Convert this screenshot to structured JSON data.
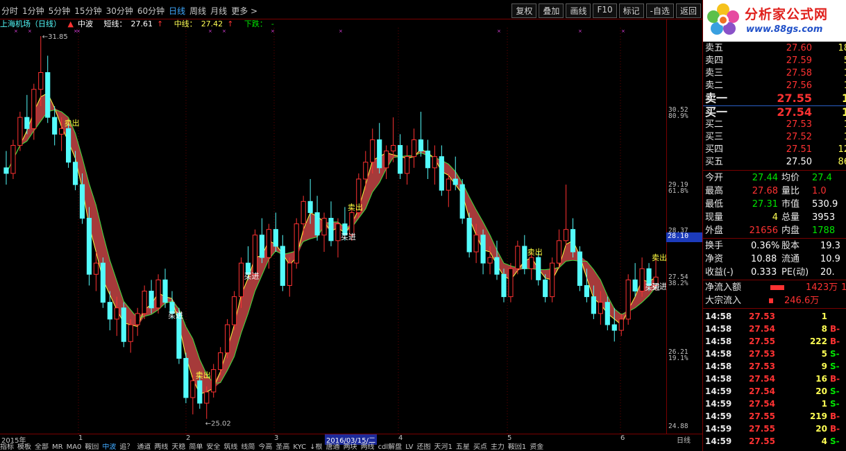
{
  "toolbar": {
    "periods": [
      "分时",
      "1分钟",
      "5分钟",
      "15分钟",
      "30分钟",
      "60分钟",
      "日线",
      "周线",
      "月线",
      "更多 >"
    ],
    "active_period": "日线",
    "tools": [
      "复权",
      "叠加",
      "画线",
      "F10",
      "标记",
      "-自选",
      "返回"
    ]
  },
  "indicator_line": {
    "stock": "上海机场（日线）",
    "indicator": "中波",
    "short_label": "短线：",
    "short_value": "27.61",
    "mid_label": "中线：",
    "mid_value": "27.42",
    "down_label": "下跌：",
    "down_value": "-"
  },
  "chart_data": {
    "type": "candlestick",
    "title": "上海机场（日线）",
    "ylim": [
      24.88,
      31.9
    ],
    "y_ticks": [
      {
        "price": "30.52",
        "pct": "80.9%"
      },
      {
        "price": "29.19",
        "pct": "61.8%"
      },
      {
        "price": "28.37",
        "pct": ""
      },
      {
        "price": "27.54",
        "pct": "38.2%"
      },
      {
        "price": "26.21",
        "pct": "19.1%"
      },
      {
        "price": "24.88",
        "pct": ""
      }
    ],
    "current_price": "28.10",
    "high_marker": "31.85",
    "low_marker": "25.02",
    "signals": [
      {
        "index": 9,
        "text": "卖出",
        "type": "sell"
      },
      {
        "index": 24,
        "text": "买进",
        "type": "buy"
      },
      {
        "index": 28,
        "text": "卖出",
        "type": "sell"
      },
      {
        "index": 35,
        "text": "买进",
        "type": "buy"
      },
      {
        "index": 49,
        "text": "买进",
        "type": "buy"
      },
      {
        "index": 50,
        "text": "卖出",
        "type": "sell"
      },
      {
        "index": 76,
        "text": "卖出",
        "type": "sell"
      },
      {
        "index": 93,
        "text": "买进",
        "type": "buy"
      },
      {
        "index": 103,
        "text": "卖出",
        "type": "sell"
      },
      {
        "index": 111,
        "text": "买进",
        "type": "buy"
      }
    ],
    "candles": [
      [
        29.5,
        29.8,
        29.2,
        29.4
      ],
      [
        29.4,
        30.0,
        29.3,
        29.9
      ],
      [
        29.9,
        30.5,
        29.8,
        30.4
      ],
      [
        30.4,
        30.8,
        30.1,
        30.2
      ],
      [
        30.2,
        31.0,
        30.0,
        30.9
      ],
      [
        30.9,
        31.85,
        30.6,
        31.2
      ],
      [
        31.2,
        31.5,
        30.3,
        30.4
      ],
      [
        30.4,
        30.6,
        29.9,
        30.1
      ],
      [
        30.1,
        30.4,
        29.8,
        30.2
      ],
      [
        30.2,
        30.3,
        29.5,
        29.6
      ],
      [
        29.6,
        29.8,
        29.1,
        29.2
      ],
      [
        29.2,
        29.4,
        28.5,
        28.6
      ],
      [
        28.6,
        28.8,
        27.4,
        27.6
      ],
      [
        27.6,
        28.0,
        27.3,
        27.8
      ],
      [
        27.8,
        27.9,
        27.0,
        27.1
      ],
      [
        27.1,
        27.3,
        26.6,
        26.8
      ],
      [
        26.8,
        27.2,
        26.5,
        27.0
      ],
      [
        27.0,
        27.1,
        26.3,
        26.4
      ],
      [
        26.4,
        26.8,
        26.2,
        26.7
      ],
      [
        26.7,
        27.0,
        26.5,
        26.9
      ],
      [
        26.9,
        27.4,
        26.8,
        27.3
      ],
      [
        27.3,
        27.5,
        26.9,
        27.0
      ],
      [
        27.0,
        27.6,
        26.9,
        27.5
      ],
      [
        27.5,
        27.7,
        27.0,
        27.1
      ],
      [
        27.1,
        27.3,
        26.8,
        26.9
      ],
      [
        26.9,
        27.0,
        26.0,
        26.1
      ],
      [
        26.1,
        26.2,
        25.3,
        25.4
      ],
      [
        25.4,
        25.8,
        25.1,
        25.7
      ],
      [
        25.7,
        25.8,
        25.2,
        25.3
      ],
      [
        25.3,
        25.6,
        25.02,
        25.5
      ],
      [
        25.5,
        26.0,
        25.4,
        25.9
      ],
      [
        25.9,
        26.3,
        25.8,
        26.2
      ],
      [
        26.2,
        26.8,
        26.1,
        26.7
      ],
      [
        26.7,
        27.3,
        26.6,
        27.2
      ],
      [
        27.2,
        27.9,
        27.0,
        27.8
      ],
      [
        27.8,
        28.1,
        27.5,
        27.6
      ],
      [
        27.6,
        28.4,
        27.5,
        28.3
      ],
      [
        28.3,
        28.6,
        27.8,
        27.9
      ],
      [
        27.9,
        28.5,
        27.7,
        28.4
      ],
      [
        28.4,
        28.7,
        28.0,
        28.1
      ],
      [
        28.1,
        28.3,
        27.3,
        27.4
      ],
      [
        27.4,
        27.9,
        27.2,
        27.8
      ],
      [
        27.8,
        28.6,
        27.7,
        28.5
      ],
      [
        28.5,
        29.0,
        28.3,
        28.9
      ],
      [
        28.9,
        29.3,
        28.5,
        28.7
      ],
      [
        28.7,
        29.0,
        28.2,
        28.3
      ],
      [
        28.3,
        28.7,
        28.0,
        28.6
      ],
      [
        28.6,
        28.9,
        28.1,
        28.2
      ],
      [
        28.2,
        28.6,
        27.9,
        28.5
      ],
      [
        28.5,
        28.8,
        28.2,
        28.3
      ],
      [
        28.3,
        28.8,
        28.2,
        28.7
      ],
      [
        28.7,
        29.4,
        28.6,
        29.3
      ],
      [
        29.3,
        29.8,
        29.1,
        29.6
      ],
      [
        29.6,
        30.2,
        29.4,
        30.0
      ],
      [
        30.0,
        30.3,
        29.4,
        29.5
      ],
      [
        29.5,
        29.9,
        29.3,
        29.8
      ],
      [
        29.8,
        30.4,
        29.6,
        29.9
      ],
      [
        29.9,
        30.1,
        29.3,
        29.4
      ],
      [
        29.4,
        29.9,
        29.2,
        29.7
      ],
      [
        29.7,
        30.2,
        29.5,
        30.0
      ],
      [
        30.0,
        30.5,
        29.7,
        29.8
      ],
      [
        29.8,
        30.0,
        29.3,
        29.5
      ],
      [
        29.5,
        29.9,
        29.2,
        29.7
      ],
      [
        29.7,
        29.9,
        29.0,
        29.1
      ],
      [
        29.1,
        29.4,
        28.8,
        29.3
      ],
      [
        29.3,
        29.7,
        29.1,
        29.2
      ],
      [
        29.2,
        29.3,
        28.5,
        28.6
      ],
      [
        28.6,
        28.7,
        27.9,
        28.0
      ],
      [
        28.0,
        28.5,
        27.8,
        28.3
      ],
      [
        28.3,
        28.4,
        27.6,
        27.8
      ],
      [
        27.8,
        28.1,
        27.6,
        27.9
      ],
      [
        27.9,
        28.2,
        27.5,
        27.6
      ],
      [
        27.6,
        27.7,
        27.1,
        27.2
      ],
      [
        27.2,
        27.8,
        27.1,
        27.7
      ],
      [
        27.7,
        28.2,
        27.6,
        28.1
      ],
      [
        28.1,
        28.3,
        27.6,
        27.7
      ],
      [
        27.7,
        28.0,
        27.5,
        27.9
      ],
      [
        27.9,
        28.0,
        27.4,
        27.5
      ],
      [
        27.5,
        27.6,
        27.1,
        27.2
      ],
      [
        27.2,
        27.9,
        27.1,
        27.8
      ],
      [
        27.8,
        28.4,
        27.7,
        28.2
      ],
      [
        28.2,
        29.2,
        28.1,
        28.4
      ],
      [
        28.4,
        28.6,
        27.9,
        28.0
      ],
      [
        28.0,
        28.1,
        27.3,
        27.4
      ],
      [
        27.4,
        27.7,
        27.1,
        27.2
      ],
      [
        27.2,
        27.4,
        26.8,
        26.9
      ],
      [
        26.9,
        27.3,
        26.7,
        27.1
      ],
      [
        27.1,
        27.2,
        26.6,
        26.7
      ],
      [
        26.7,
        27.0,
        26.4,
        26.6
      ],
      [
        26.6,
        26.9,
        26.5,
        26.8
      ],
      [
        26.8,
        27.6,
        26.7,
        27.5
      ],
      [
        27.5,
        27.8,
        27.2,
        27.3
      ],
      [
        27.3,
        27.9,
        27.2,
        27.7
      ],
      [
        27.7,
        27.8,
        27.3,
        27.4
      ],
      [
        27.4,
        27.9,
        27.31,
        27.55
      ]
    ]
  },
  "date_strip": {
    "year": "2015年",
    "months": [
      "1",
      "2",
      "3",
      "4",
      "5",
      "6"
    ],
    "selected": "2016/03/15/二",
    "period": "日线"
  },
  "bottom_tabs": [
    "指标",
    "模板",
    "全部",
    "MR",
    "MA0",
    "鞍回",
    "中波",
    "追？",
    "通道",
    "两线",
    "天稳",
    "简单",
    "安全",
    "筑线",
    "线简",
    "今高",
    "圣高",
    "KYC",
    "↓根",
    "唐通",
    "两块",
    "两线",
    "cdl解盘",
    "LV",
    "还图",
    "天河1",
    "五星",
    "买点",
    "主力",
    "鞍回1",
    "资金"
  ],
  "active_tab": "中波",
  "panel": {
    "brand": "分析家公式网",
    "url": "www.88gs.com",
    "asks": [
      {
        "label": "卖五",
        "price": "27.60",
        "vol": "18"
      },
      {
        "label": "卖四",
        "price": "27.59",
        "vol": "5"
      },
      {
        "label": "卖三",
        "price": "27.58",
        "vol": "1"
      },
      {
        "label": "卖二",
        "price": "27.56",
        "vol": "1"
      },
      {
        "label": "卖一",
        "price": "27.55",
        "vol": "1"
      }
    ],
    "bids": [
      {
        "label": "买一",
        "price": "27.54",
        "vol": "1"
      },
      {
        "label": "买二",
        "price": "27.53",
        "vol": "1"
      },
      {
        "label": "买三",
        "price": "27.52",
        "vol": "1"
      },
      {
        "label": "买四",
        "price": "27.51",
        "vol": "12"
      },
      {
        "label": "买五",
        "price": "27.50",
        "vol": "86"
      }
    ],
    "stats": [
      {
        "k1": "今开",
        "v1": "27.44",
        "c1": "green",
        "k2": "均价",
        "v2": "27.4",
        "c2": "green"
      },
      {
        "k1": "最高",
        "v1": "27.68",
        "c1": "red",
        "k2": "量比",
        "v2": "1.0",
        "c2": "red"
      },
      {
        "k1": "最低",
        "v1": "27.31",
        "c1": "green",
        "k2": "市值",
        "v2": "530.9",
        "c2": "white"
      },
      {
        "k1": "现量",
        "v1": "4",
        "c1": "yellow",
        "k2": "总量",
        "v2": "3953",
        "c2": "white"
      },
      {
        "k1": "外盘",
        "v1": "21656",
        "c1": "red",
        "k2": "内盘",
        "v2": "1788",
        "c2": "green"
      }
    ],
    "stats2": [
      {
        "k1": "换手",
        "v1": "0.36%",
        "c1": "white",
        "k2": "股本",
        "v2": "19.3",
        "c2": "white"
      },
      {
        "k1": "净资",
        "v1": "10.88",
        "c1": "white",
        "k2": "流通",
        "v2": "10.9",
        "c2": "white"
      },
      {
        "k1": "收益(-)",
        "v1": "0.333",
        "c1": "white",
        "k2": "PE(动)",
        "v2": "20.",
        "c2": "white"
      }
    ],
    "flows": [
      {
        "k": "净流入额",
        "v": "1423万",
        "extra": "1"
      },
      {
        "k": "大宗流入",
        "v": "246.6万",
        "extra": ""
      }
    ],
    "ticks": [
      {
        "t": "14:58",
        "p": "27.53",
        "q": "1",
        "d": ""
      },
      {
        "t": "14:58",
        "p": "27.54",
        "q": "8",
        "d": "B"
      },
      {
        "t": "14:58",
        "p": "27.55",
        "q": "222",
        "d": "B"
      },
      {
        "t": "14:58",
        "p": "27.53",
        "q": "5",
        "d": "S"
      },
      {
        "t": "14:58",
        "p": "27.53",
        "q": "9",
        "d": "S"
      },
      {
        "t": "14:58",
        "p": "27.54",
        "q": "16",
        "d": "B"
      },
      {
        "t": "14:59",
        "p": "27.54",
        "q": "20",
        "d": "S"
      },
      {
        "t": "14:59",
        "p": "27.54",
        "q": "1",
        "d": "S"
      },
      {
        "t": "14:59",
        "p": "27.55",
        "q": "219",
        "d": "B"
      },
      {
        "t": "14:59",
        "p": "27.55",
        "q": "20",
        "d": "B"
      },
      {
        "t": "14:59",
        "p": "27.55",
        "q": "4",
        "d": "S"
      }
    ]
  }
}
